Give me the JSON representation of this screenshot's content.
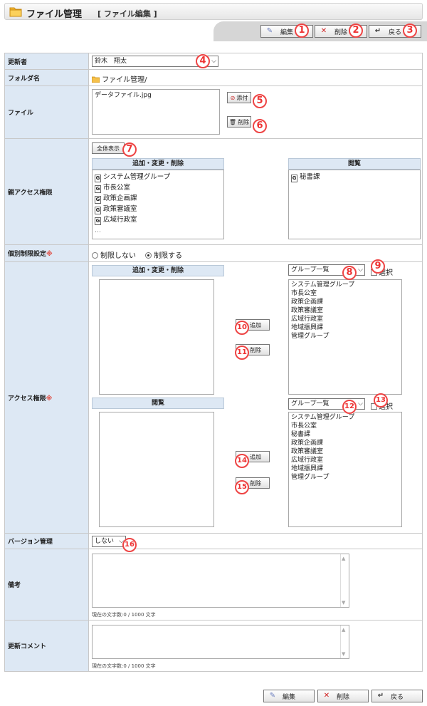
{
  "header": {
    "title": "ファイル管理",
    "subtitle": "[ ファイル編集 ]"
  },
  "toolbar": {
    "edit_label": "編集",
    "delete_label": "削除",
    "back_label": "戻る"
  },
  "callouts": [
    "1",
    "2",
    "3",
    "4",
    "5",
    "6",
    "7",
    "8",
    "9",
    "10",
    "11",
    "12",
    "13",
    "14",
    "15",
    "16"
  ],
  "updater": {
    "label": "更新者",
    "value": "鈴木　翔太"
  },
  "folder": {
    "label": "フォルダ名",
    "value": "ファイル管理/"
  },
  "file": {
    "label": "ファイル",
    "filename": "データファイル.jpg",
    "attach_label": "添付",
    "delete_label": "削除"
  },
  "parent_access": {
    "label": "親アクセス権限",
    "show_all_label": "全体表示",
    "edit_head": "追加・変更・削除",
    "view_head": "閲覧",
    "edit_items": [
      "システム管理グループ",
      "市長公室",
      "政策企画課",
      "政策審議室",
      "広域行政室",
      "..."
    ],
    "view_items": [
      "秘書課"
    ]
  },
  "restriction": {
    "label": "個別制限設定",
    "option_no": "制限しない",
    "option_yes": "制限する",
    "selected": "制限する"
  },
  "access": {
    "label": "アクセス権限",
    "edit_head": "追加・変更・削除",
    "view_head": "閲覧",
    "group_select": "グループ一覧",
    "select_label": "選択",
    "add_label": "追加",
    "remove_label": "削除",
    "edit_groups": [
      "システム管理グループ",
      "市長公室",
      "政策企画課",
      "政策審議室",
      "広域行政室",
      "地域振興課",
      "管理グループ"
    ],
    "view_groups": [
      "システム管理グループ",
      "市長公室",
      "秘書課",
      "政策企画課",
      "政策審議室",
      "広域行政室",
      "地域振興課",
      "管理グループ"
    ]
  },
  "version": {
    "label": "バージョン管理",
    "value": "しない"
  },
  "remarks": {
    "label": "備考",
    "counter": "現在の文字数:0 / 1000 文字"
  },
  "update_comment": {
    "label": "更新コメント",
    "counter": "現在の文字数:0 / 1000 文字"
  },
  "required_mark": "※"
}
